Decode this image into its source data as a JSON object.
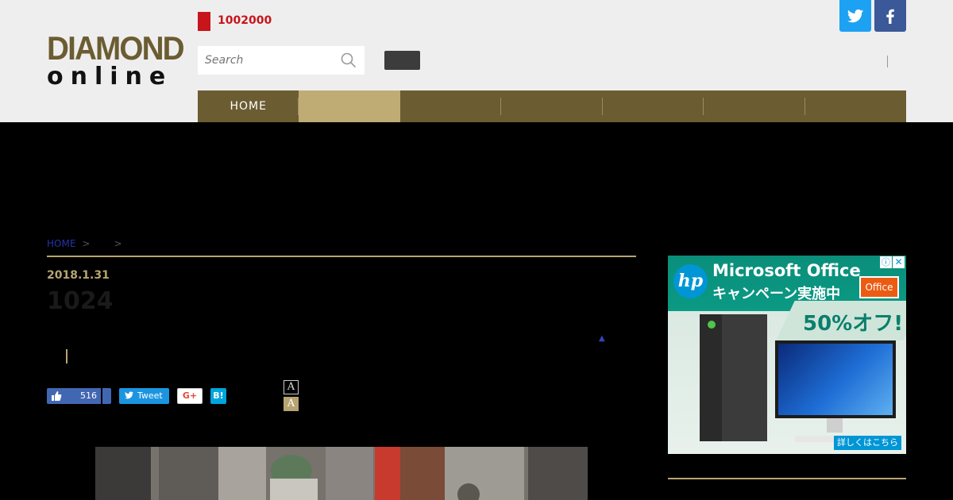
{
  "header": {
    "logo": {
      "line1": "DIAMOND",
      "line2": "online"
    },
    "promo_text": "1002000",
    "search_placeholder": "Search"
  },
  "nav": [
    {
      "label": "HOME",
      "active": false
    },
    {
      "label": "",
      "active": true
    },
    {
      "label": "",
      "active": false
    },
    {
      "label": "",
      "active": false
    },
    {
      "label": "",
      "active": false
    },
    {
      "label": "",
      "active": false
    },
    {
      "label": "",
      "active": false
    }
  ],
  "article": {
    "breadcrumb_home": "HOME",
    "breadcrumb_sep": ">",
    "date": "2018.1.31",
    "title": "1024",
    "like_count": "516",
    "tweet_label": "Tweet",
    "gplus_label": "G+",
    "hatena_label": "B!",
    "font_size_a": "A",
    "font_size_b": "A"
  },
  "ad": {
    "brand": "hp",
    "headline": "Microsoft Office",
    "subheadline": "キャンペーン実施中",
    "badge": "Office",
    "offer": "50%オフ!",
    "cta": "詳しくはこちら"
  },
  "colors": {
    "brand_gold": "#6b5c32",
    "active_tab": "#bfab74",
    "accent_line": "#b8a472",
    "promo_red": "#c8141b"
  }
}
